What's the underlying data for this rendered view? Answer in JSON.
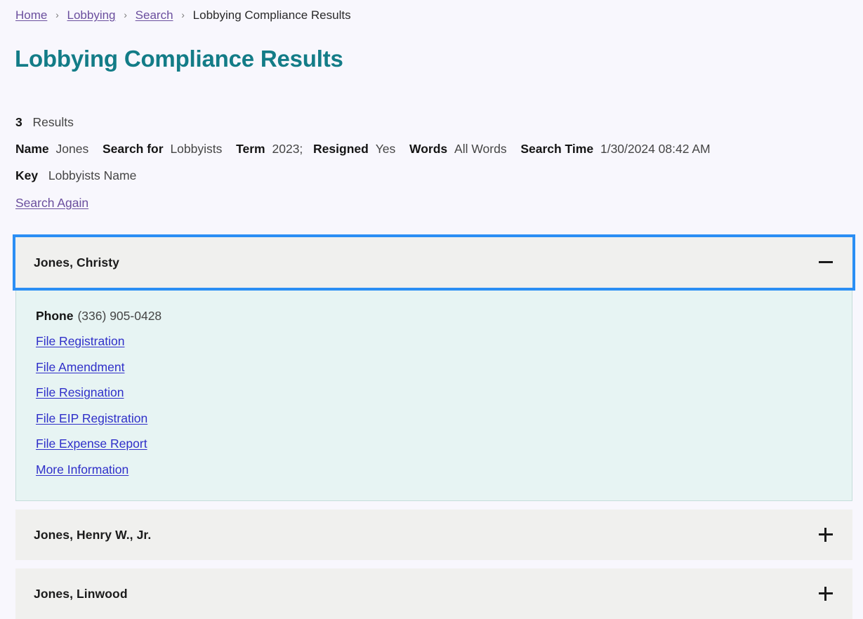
{
  "breadcrumb": {
    "items": [
      {
        "label": "Home",
        "link": true
      },
      {
        "label": "Lobbying",
        "link": true
      },
      {
        "label": "Search",
        "link": true
      },
      {
        "label": "Lobbying Compliance Results",
        "link": false
      }
    ],
    "separator": "›"
  },
  "page_title": "Lobbying Compliance Results",
  "summary": {
    "count": "3",
    "count_label": "Results",
    "criteria": [
      {
        "label": "Name",
        "value": "Jones"
      },
      {
        "label": "Search for",
        "value": "Lobbyists"
      },
      {
        "label": "Term",
        "value": "2023;"
      },
      {
        "label": "Resigned",
        "value": "Yes"
      },
      {
        "label": "Words",
        "value": "All Words"
      },
      {
        "label": "Search Time",
        "value": "1/30/2024 08:42 AM"
      }
    ],
    "key_label": "Key",
    "key_value": "Lobbyists Name",
    "search_again": "Search Again"
  },
  "results": [
    {
      "name": "Jones, Christy",
      "expanded": true,
      "focused": true,
      "toggle_icon": "minus-icon",
      "phone_label": "Phone",
      "phone_value": "(336) 905-0428",
      "links": [
        "File Registration",
        "File Amendment",
        "File Resignation",
        "File EIP Registration",
        "File Expense Report",
        "More Information"
      ]
    },
    {
      "name": "Jones, Henry W., Jr.",
      "expanded": false,
      "focused": false,
      "toggle_icon": "plus-icon"
    },
    {
      "name": "Jones, Linwood",
      "expanded": false,
      "focused": false,
      "toggle_icon": "plus-icon"
    }
  ],
  "colors": {
    "page_background": "#f8f7fd",
    "heading_teal": "#137c87",
    "visited_link_purple": "#6b4f9e",
    "link_blue": "#2f2fc9",
    "focus_ring_blue": "#2b8ef4",
    "accordion_header_gray": "#f0f0ee",
    "panel_mint": "#e7f4f3"
  }
}
